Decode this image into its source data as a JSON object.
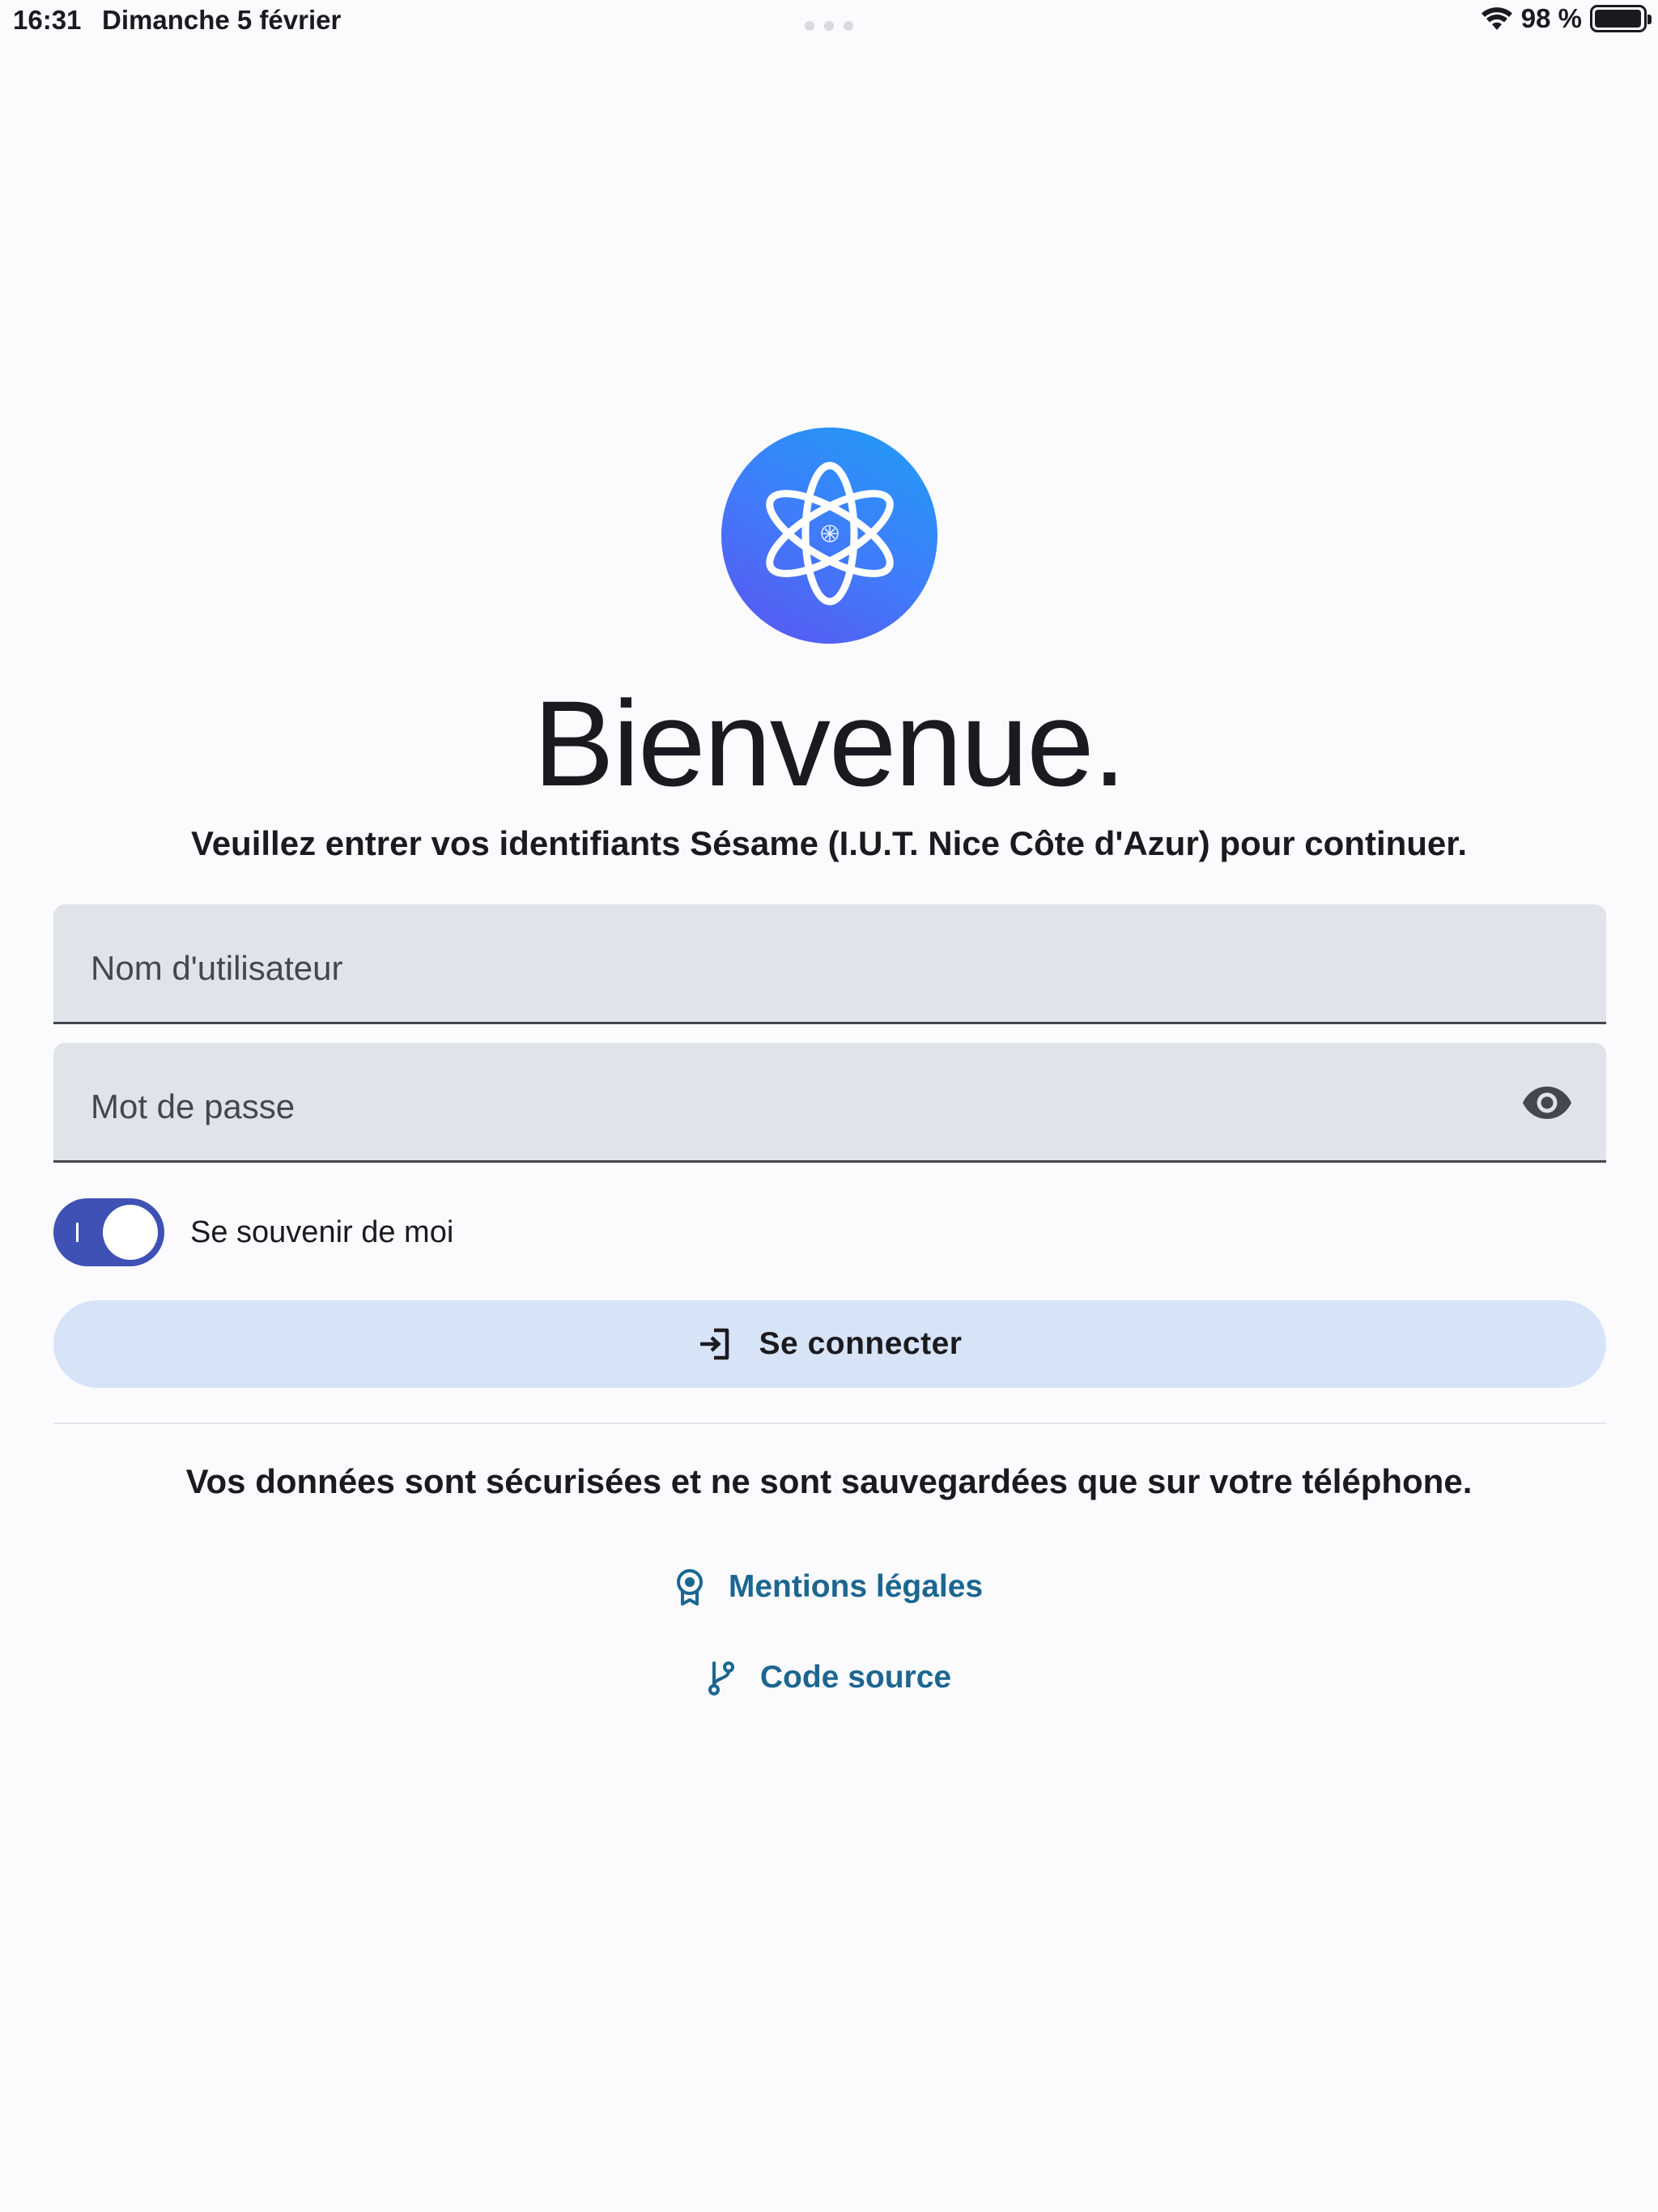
{
  "status_bar": {
    "time": "16:31",
    "date": "Dimanche 5 février",
    "battery_text": "98 %",
    "battery_level": 0.98,
    "icons": [
      "wifi-icon",
      "battery-icon"
    ]
  },
  "logo": {
    "icon": "atom-icon",
    "gradient": [
      "#5b54f0",
      "#1f9ef6"
    ]
  },
  "welcome": {
    "title": "Bienvenue.",
    "subtitle": "Veuillez entrer vos identifiants Sésame (I.U.T. Nice Côte d'Azur) pour continuer."
  },
  "form": {
    "username": {
      "value": "",
      "placeholder": "Nom d'utilisateur"
    },
    "password": {
      "value": "",
      "placeholder": "Mot de passe",
      "toggle_icon": "eye-icon"
    },
    "remember": {
      "label": "Se souvenir de moi",
      "checked": true
    },
    "submit": {
      "label": "Se connecter",
      "icon": "login-icon"
    }
  },
  "footer": {
    "secure_text": "Vos données sont sécurisées et ne sont sauvegardées que sur votre téléphone.",
    "links": [
      {
        "label": "Mentions légales",
        "icon": "badge-icon"
      },
      {
        "label": "Code source",
        "icon": "git-branch-icon"
      }
    ]
  },
  "colors": {
    "background": "#fbfbfe",
    "field_background": "#e0e3ea",
    "toggle_on": "#3f51b5",
    "button_background": "#d7e3f7",
    "link": "#1c6690"
  }
}
